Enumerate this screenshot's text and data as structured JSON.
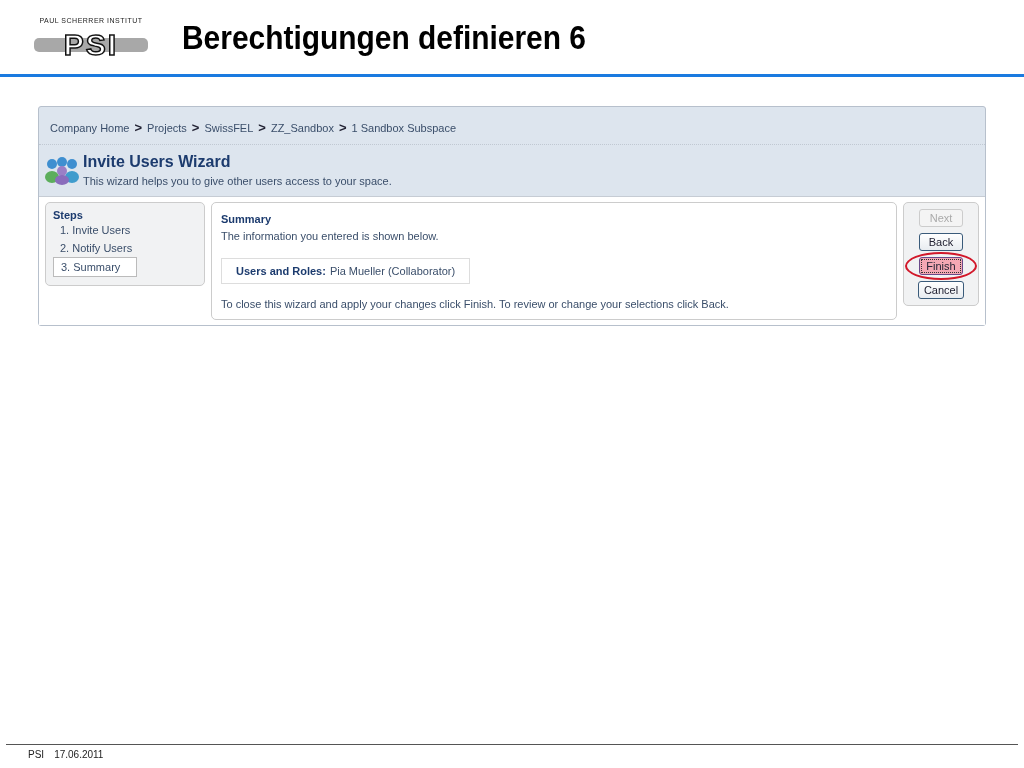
{
  "logo": {
    "caption": "PAUL SCHERRER INSTITUT",
    "mark": "PSI"
  },
  "slide_title": "Berechtigungen definieren 6",
  "breadcrumb": [
    "Company Home",
    "Projects",
    "SwissFEL",
    "ZZ_Sandbox",
    "1 Sandbox Subspace"
  ],
  "breadcrumb_separator": ">",
  "wizard": {
    "title": "Invite Users Wizard",
    "description": "This wizard helps you to give other users access to your space."
  },
  "steps": {
    "heading": "Steps",
    "items": [
      {
        "label": "1. Invite Users",
        "selected": false
      },
      {
        "label": "2. Notify Users",
        "selected": false
      },
      {
        "label": "3. Summary",
        "selected": true
      }
    ]
  },
  "summary": {
    "heading": "Summary",
    "intro": "The information you entered is shown below.",
    "field_label": "Users and Roles:",
    "field_value": "Pia Mueller (Collaborator)",
    "footer": "To close this wizard and apply your changes click Finish. To review or change your selections click Back."
  },
  "buttons": [
    {
      "label": "Next",
      "disabled": true,
      "focused": false,
      "circled": false
    },
    {
      "label": "Back",
      "disabled": false,
      "focused": false,
      "circled": false
    },
    {
      "label": "Finish",
      "disabled": false,
      "focused": true,
      "circled": true
    },
    {
      "label": "Cancel",
      "disabled": false,
      "focused": false,
      "circled": false
    }
  ],
  "footer": {
    "org": "PSI",
    "date": "17.06.2011"
  }
}
